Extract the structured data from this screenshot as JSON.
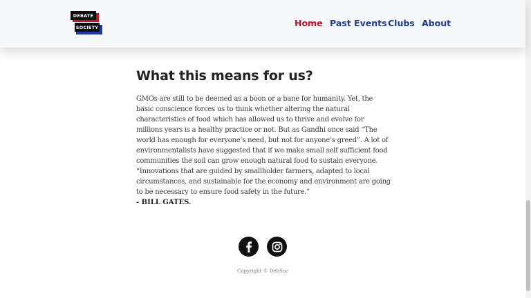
{
  "logo": {
    "line1": "DEBATE",
    "line2": "SOCIETY"
  },
  "nav": [
    {
      "label": "Home",
      "active": true
    },
    {
      "label": "Past Events",
      "active": false
    },
    {
      "label": "Clubs",
      "active": false
    },
    {
      "label": "About",
      "active": false
    }
  ],
  "article": {
    "heading": "What this means for us?",
    "body": "GMOs are still to be deemed as a boon or a bane for humanity. Yet, the basic conscience forces us to think whether altering the natural characteristics of food which has allowed us to thrive and evolve for millions years is a healthy practice or not. But as Gandhi once said “The world has enough for everyone’s need, but not for anyone’s greed”. A lot of environmentalists have suggested that if we make small self sufficient food communities the soil can grow enough natural food to sustain everyone. “Innovations that are guided by smallholder farmers, adapted to local circumstances, and sustainable for the economy and environment are going to be necessary to ensure food safety in the future.”",
    "author": "- BILL GATES."
  },
  "social": [
    {
      "icon": "facebook-icon"
    },
    {
      "icon": "instagram-icon"
    }
  ],
  "footer": {
    "copyright": "Copyright © DebSoc"
  },
  "colors": {
    "accent_red": "#c0122c",
    "nav_blue": "#1e3a8a",
    "logo_red": "#c8102e",
    "logo_blue": "#1f3aa8"
  }
}
